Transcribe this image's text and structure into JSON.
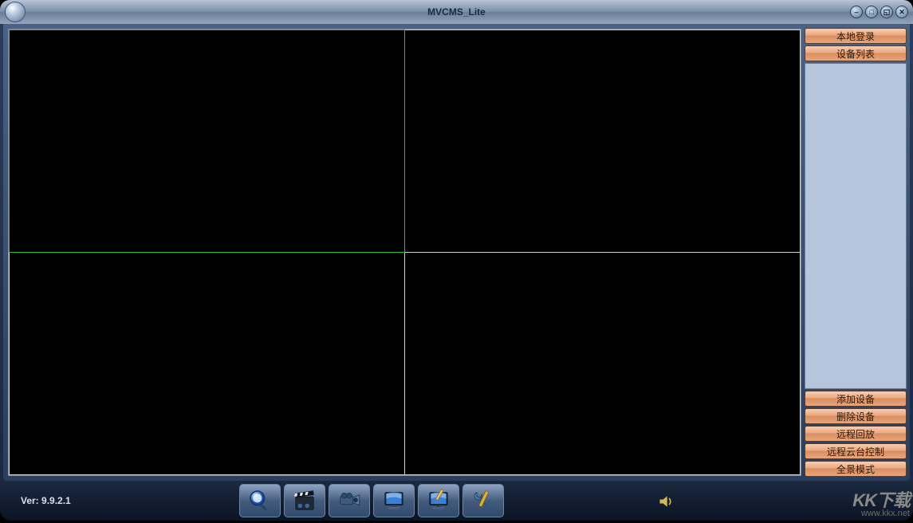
{
  "window": {
    "title": "MVCMS_Lite"
  },
  "winbuttons": {
    "b1": "⎯",
    "b2": "□",
    "b3": "◱",
    "b4": "✕"
  },
  "sidebar": {
    "top": [
      {
        "label": "本地登录"
      },
      {
        "label": "设备列表"
      }
    ],
    "bottom": [
      {
        "label": "添加设备"
      },
      {
        "label": "删除设备"
      },
      {
        "label": "远程回放"
      },
      {
        "label": "远程云台控制"
      },
      {
        "label": "全景模式"
      }
    ]
  },
  "footer": {
    "version": "Ver: 9.9.2.1"
  },
  "toolbar": {
    "items": [
      {
        "name": "search"
      },
      {
        "name": "clapper"
      },
      {
        "name": "camcorder"
      },
      {
        "name": "monitor"
      },
      {
        "name": "monitor-write"
      },
      {
        "name": "tools"
      }
    ]
  },
  "watermark": {
    "line1": "KK下载",
    "line2": "www.kkx.net"
  }
}
